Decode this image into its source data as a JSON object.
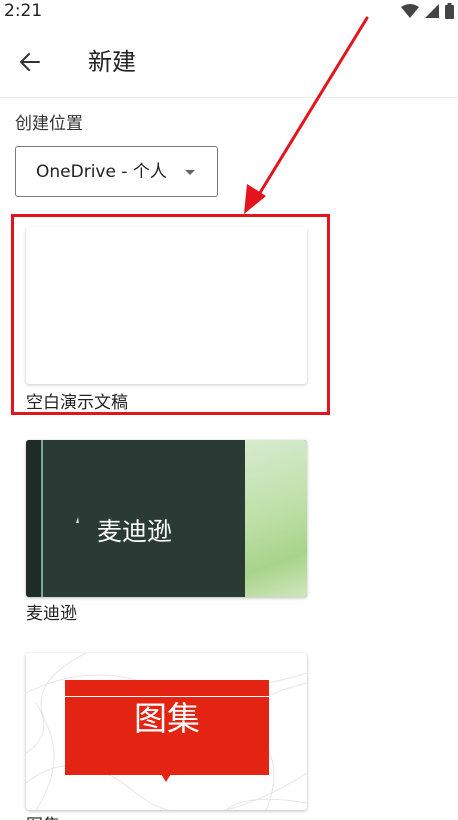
{
  "status_bar": {
    "time": "2:21",
    "icons": [
      "wifi-icon",
      "cell-signal-icon",
      "battery-icon"
    ]
  },
  "app_bar": {
    "back_icon": "arrow-left-icon",
    "title": "新建"
  },
  "location": {
    "label": "创建位置",
    "selected": "OneDrive - 个人"
  },
  "templates": [
    {
      "name": "空白演示文稿",
      "thumbnail_text": ""
    },
    {
      "name": "麦迪逊",
      "thumbnail_text": "麦迪逊"
    },
    {
      "name": "图集",
      "thumbnail_text": "图集"
    }
  ],
  "annotation": {
    "color": "#e3141b",
    "target": "空白演示文稿"
  }
}
